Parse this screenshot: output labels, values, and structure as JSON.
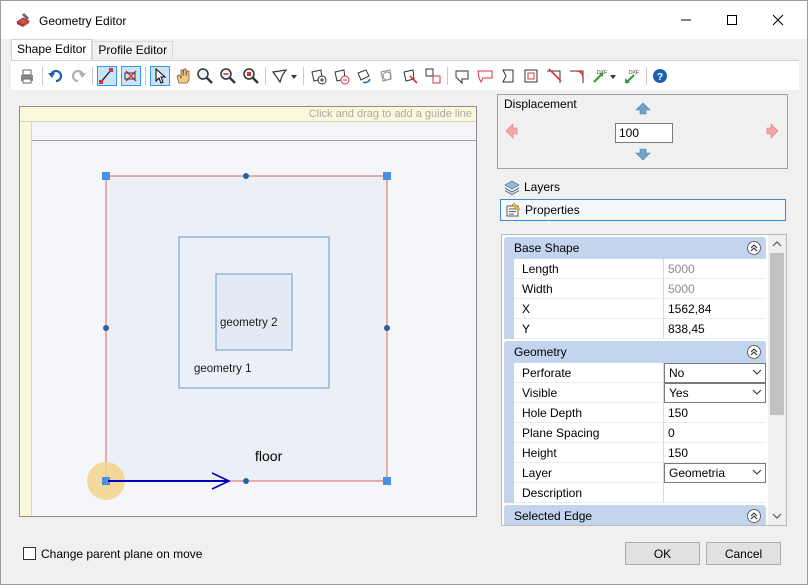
{
  "window": {
    "title": "Geometry Editor",
    "icon": "geometry-editor-icon"
  },
  "tabs": [
    {
      "label": "Shape Editor",
      "active": true
    },
    {
      "label": "Profile Editor",
      "active": false
    }
  ],
  "toolbar": {
    "icons": [
      "print-icon",
      "undo-icon",
      "redo-icon",
      "snap-icon",
      "snap-disable-icon",
      "pointer-icon",
      "pan-hand-icon",
      "zoom-icon",
      "zoom-out-icon",
      "zoom-window-icon",
      "polygon-icon",
      "dropdown-icon",
      "add-shape-icon",
      "subtract-shape-icon",
      "rotate-shape-icon",
      "circle-shape-icon",
      "cut-shape-icon",
      "move-shape-icon",
      "shape-tool-1-icon",
      "shape-tool-2-icon",
      "shape-tool-3-icon",
      "shape-tool-4-icon",
      "edge-cut-icon",
      "edge-trim-icon",
      "dxf-export-icon",
      "dxf-import-icon",
      "help-icon"
    ]
  },
  "canvas": {
    "guide_hint": "Click and drag to add a guide line",
    "labels": {
      "geometry2": "geometry 2",
      "geometry1": "geometry 1",
      "floor": "floor"
    },
    "colors": {
      "outer_border": "#e06060",
      "handle": "#4a90e2",
      "inner_border": "#6a9bd1",
      "arrow": "#0000b4",
      "origin": "#f2d48a"
    }
  },
  "displacement": {
    "label": "Displacement",
    "value": "100"
  },
  "panels": {
    "layers": "Layers",
    "properties": "Properties"
  },
  "properties": {
    "base_shape": {
      "title": "Base Shape",
      "rows": [
        {
          "name": "Length",
          "value": "5000",
          "readonly": true
        },
        {
          "name": "Width",
          "value": "5000",
          "readonly": true
        },
        {
          "name": "X",
          "value": "1562,84",
          "readonly": false
        },
        {
          "name": "Y",
          "value": "838,45",
          "readonly": false
        }
      ]
    },
    "geometry": {
      "title": "Geometry",
      "rows": [
        {
          "name": "Perforate",
          "value": "No",
          "combo": true
        },
        {
          "name": "Visible",
          "value": "Yes",
          "combo": true
        },
        {
          "name": "Hole Depth",
          "value": "150"
        },
        {
          "name": "Plane Spacing",
          "value": "0"
        },
        {
          "name": "Height",
          "value": "150"
        },
        {
          "name": "Layer",
          "value": "Geometria",
          "combo": true
        },
        {
          "name": "Description",
          "value": ""
        }
      ]
    },
    "selected_edge": {
      "title": "Selected Edge"
    }
  },
  "footer": {
    "checkbox_label": "Change parent plane on move",
    "ok": "OK",
    "cancel": "Cancel"
  }
}
